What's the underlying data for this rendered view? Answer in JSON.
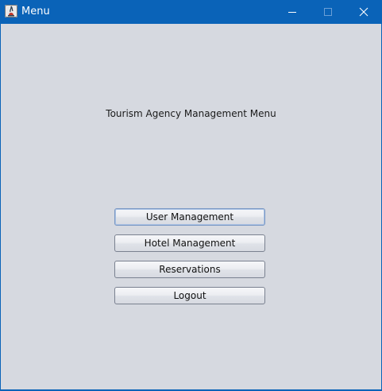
{
  "window": {
    "title": "Menu",
    "icon": "java-app-icon",
    "controls": {
      "minimize_icon": "minimize-icon",
      "maximize_icon": "maximize-icon",
      "close_icon": "close-icon"
    }
  },
  "main": {
    "heading": "Tourism Agency Management Menu",
    "buttons": [
      {
        "label": "User Management"
      },
      {
        "label": "Hotel Management"
      },
      {
        "label": "Reservations"
      },
      {
        "label": "Logout"
      }
    ]
  },
  "colors": {
    "titlebar": "#0a63b8",
    "client_background": "#d6d9e0"
  }
}
